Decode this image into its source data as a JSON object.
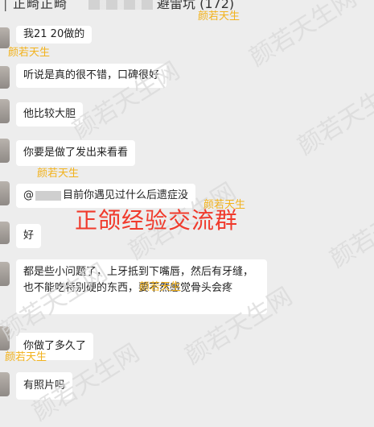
{
  "header": {
    "title_part1": "正畸正畸",
    "title_part2": "避雷坑 (172)"
  },
  "watermark": {
    "small": "颜若天生",
    "big": "颜若天生网",
    "banner": "正颌经验交流群"
  },
  "messages": [
    {
      "text": "我21  20做的"
    },
    {
      "text": "听说是真的很不错，口碑很好"
    },
    {
      "text": "他比较大胆"
    },
    {
      "text": "你要是做了发出来看看"
    },
    {
      "prefix": "@",
      "text": "目前你遇见过什么后遗症没"
    },
    {
      "text": "好"
    },
    {
      "text": "都是些小问题了，上牙抵到下嘴唇，然后有牙缝，也不能吃特别硬的东西，要不然感觉骨头会疼"
    },
    {
      "text": "你做了多久了"
    },
    {
      "text": "有照片吗"
    }
  ],
  "colors": {
    "background": "#ededed",
    "bubble": "#ffffff",
    "watermark_small": "#f2b21c",
    "banner": "#f03a2c"
  }
}
